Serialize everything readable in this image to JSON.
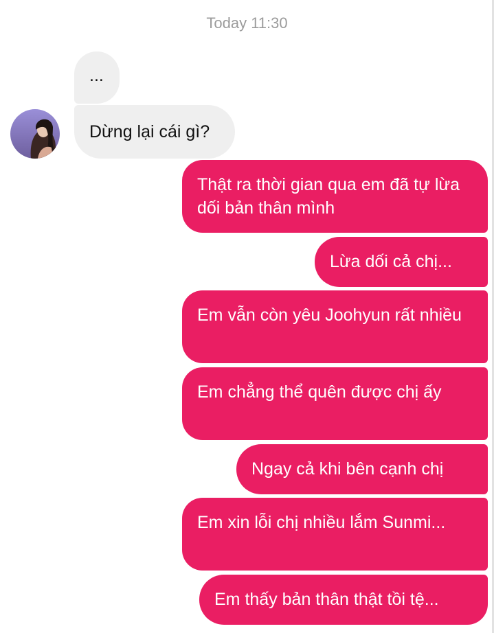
{
  "timestamp": "Today 11:30",
  "incoming": [
    {
      "text": "..."
    },
    {
      "text": "Dừng lại cái gì?"
    }
  ],
  "outgoing": [
    {
      "text": "Thật ra thời gian qua em đã tự lừa dối bản thân mình"
    },
    {
      "text": "Lừa dối cả chị..."
    },
    {
      "text": "Em vẫn còn yêu Joohyun rất nhiều"
    },
    {
      "text": "Em chẳng thể quên được chị ấy"
    },
    {
      "text": "Ngay cả khi bên cạnh chị"
    },
    {
      "text": "Em xin lỗi chị nhiều lắm Sunmi..."
    },
    {
      "text": "Em thấy bản thân thật tồi tệ..."
    }
  ],
  "colors": {
    "outgoing_bubble": "#ea1e63",
    "incoming_bubble": "#efefef",
    "timestamp_text": "#9b9b9b"
  }
}
